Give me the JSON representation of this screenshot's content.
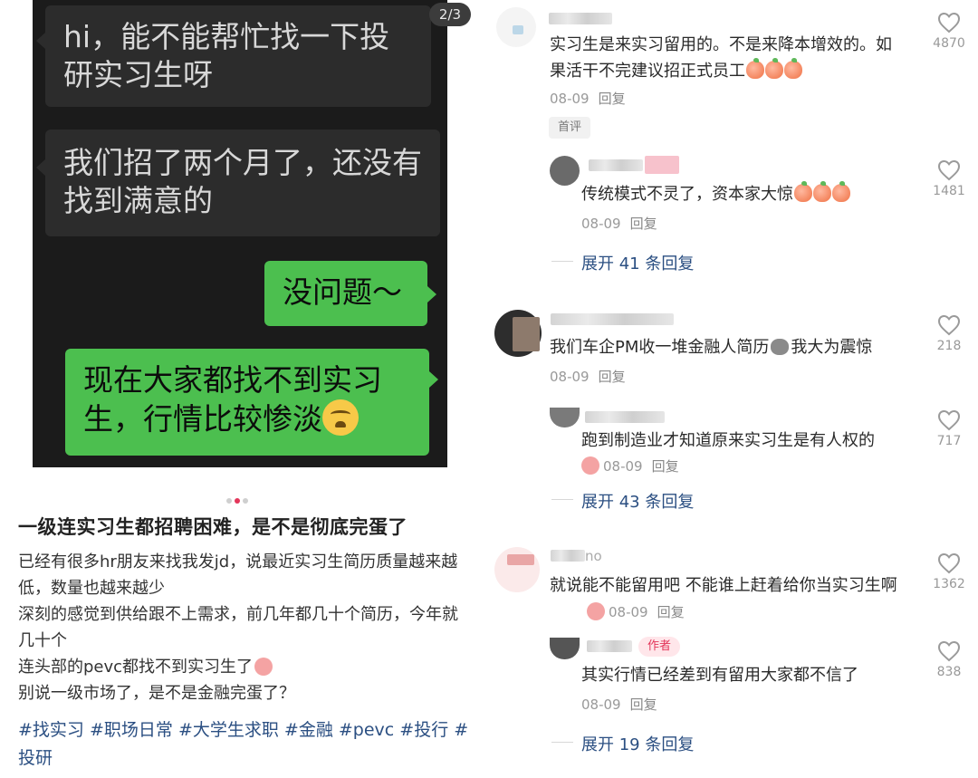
{
  "chat": {
    "counter": "2/3",
    "messages": [
      {
        "side": "in",
        "text": "hi，能不能帮忙找一下投研实习生呀"
      },
      {
        "side": "in",
        "text": "我们招了两个月了，还没有找到满意的"
      },
      {
        "side": "out",
        "text": "没问题～"
      },
      {
        "side": "out",
        "text": "现在大家都找不到实习生，行情比较惨淡",
        "emoji": "crying-face-emoji"
      }
    ]
  },
  "post": {
    "title": "一级连实习生都招聘困难，是不是彻底完蛋了",
    "body": [
      "已经有很多hr朋友来找我发jd，说最近实习生简历质量越来越低，数量也越来越少",
      "深刻的感觉到供给跟不上需求，前几年都几十个简历，今年就几十个",
      "连头部的pevc都找不到实习生了",
      "别说一级市场了，是不是金融完蛋了？"
    ],
    "tags": [
      "#找实习",
      "#职场日常",
      "#大学生求职",
      "#金融",
      "#pevc",
      "#投行",
      "#投研"
    ]
  },
  "comments": [
    {
      "text": "实习生是来实习留用的。不是来降本增效的。如果活干不完建议招正式员工",
      "date": "08-09",
      "reply": "回复",
      "likes": "4870",
      "badge": "首评",
      "sub": {
        "text": "传统模式不灵了，资本家大惊",
        "date": "08-09",
        "reply": "回复",
        "likes": "1481",
        "expand": "展开 41 条回复"
      }
    },
    {
      "text_a": "我们车企PM收一堆金融人简历",
      "text_b": "我大为震惊",
      "date": "08-09",
      "reply": "回复",
      "likes": "218",
      "sub": {
        "text": "跑到制造业才知道原来实习生是有人权的",
        "date": "08-09",
        "reply": "回复",
        "likes": "717",
        "expand": "展开 43 条回复"
      }
    },
    {
      "name_partial": "no",
      "text": "就说能不能留用吧 不能谁上赶着给你当实习生啊",
      "date": "08-09",
      "reply": "回复",
      "likes": "1362",
      "sub": {
        "badge": "作者",
        "text": "其实行情已经差到有留用大家都不信了",
        "date": "08-09",
        "reply": "回复",
        "likes": "838",
        "expand": "展开 19 条回复"
      }
    }
  ],
  "colors": {
    "chat_bg": "#1b1b1b",
    "incoming_bubble": "#2c2c2c",
    "outgoing_bubble": "#4cbf4f",
    "link": "#2b4f82",
    "accent": "#e3365a"
  }
}
